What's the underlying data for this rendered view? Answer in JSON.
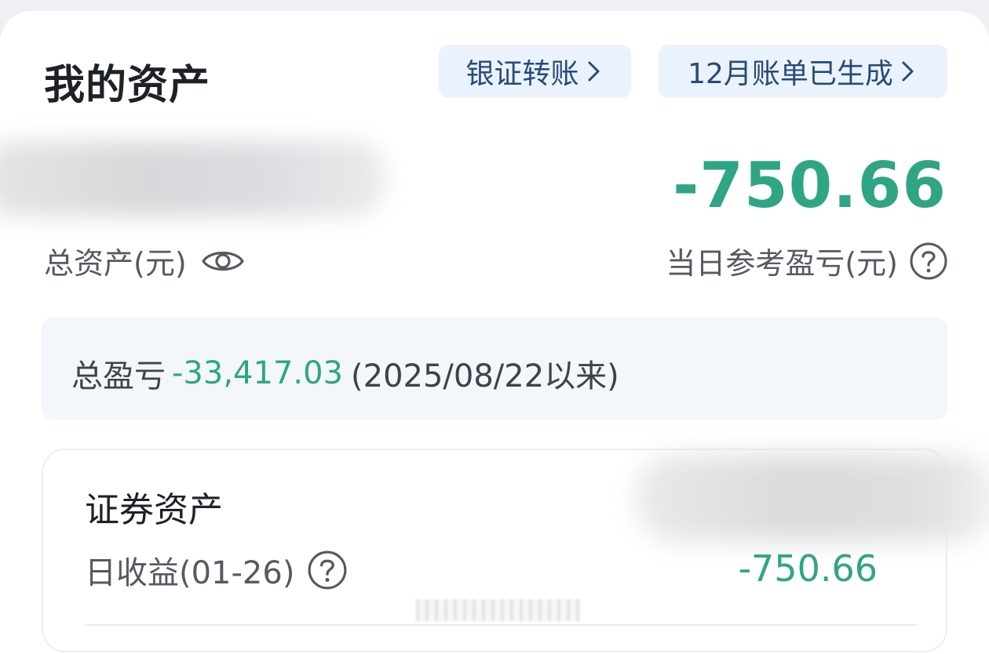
{
  "header": {
    "title": "我的资产",
    "transfer_label": "银证转账",
    "bill_label": "12月账单已生成"
  },
  "summary": {
    "daily_pnl_value": "-750.66",
    "total_assets_label": "总资产(元)",
    "daily_pnl_label": "当日参考盈亏(元)"
  },
  "total_pnl": {
    "label": "总盈亏",
    "value": "-33,417.03",
    "since": "(2025/08/22以来)"
  },
  "securities": {
    "title": "证券资产",
    "daily_label": "日收益(01-26)",
    "daily_value": "-750.66"
  },
  "colors": {
    "loss_green": "#2fa585",
    "chip_bg": "#eaf2fd",
    "chip_text": "#284a78"
  },
  "icons": {
    "visibility": "eye-icon",
    "help": "question-circle-icon",
    "chevron": "chevron-right-icon"
  }
}
